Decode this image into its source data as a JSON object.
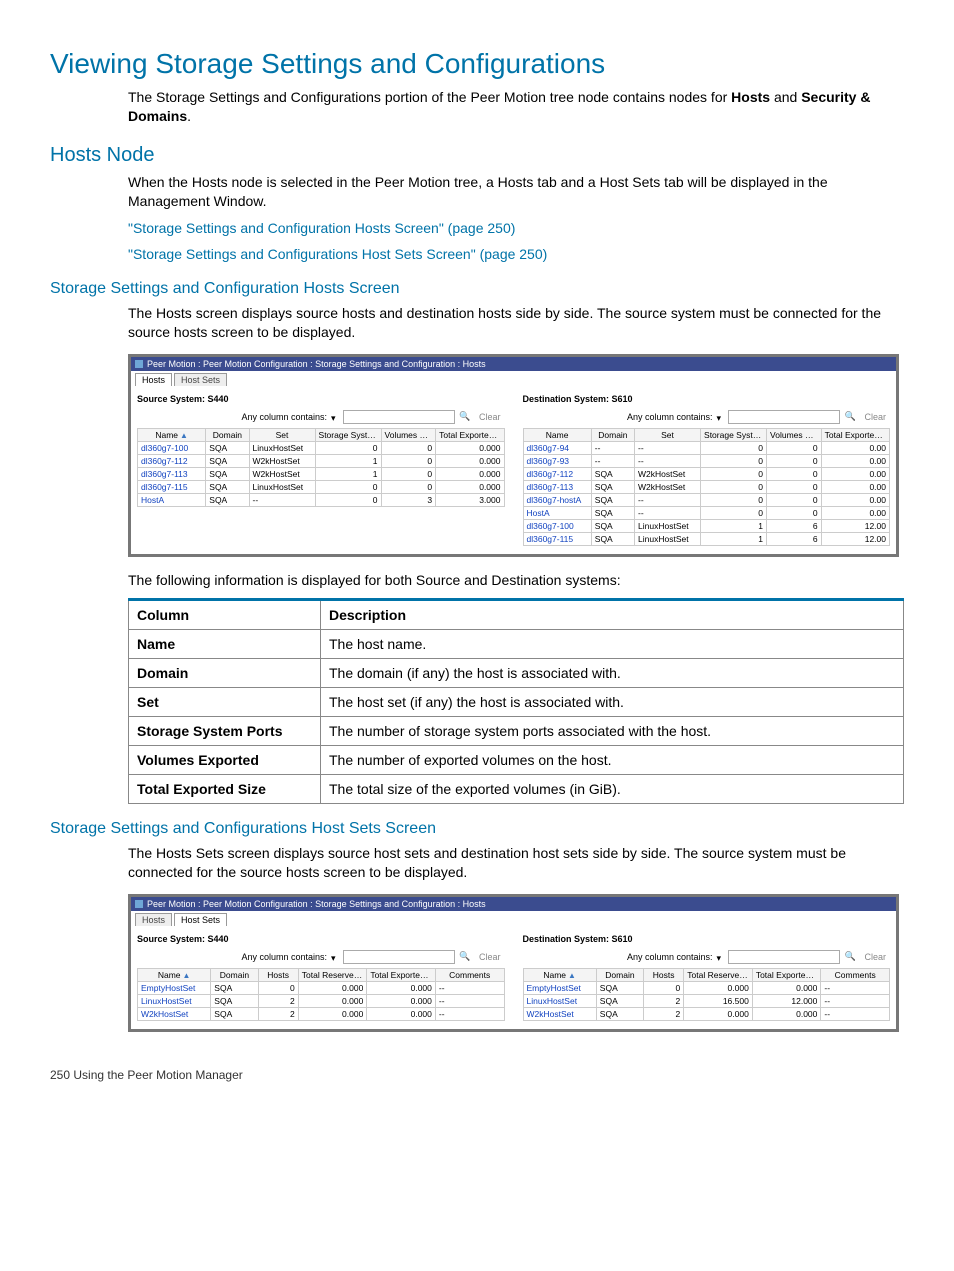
{
  "headings": {
    "h1": "Viewing Storage Settings and Configurations",
    "h2_hosts_node": "Hosts Node",
    "h3_hosts_screen": "Storage Settings and Configuration Hosts Screen",
    "h3_hostsets_screen": "Storage Settings and Configurations Host Sets Screen"
  },
  "paragraphs": {
    "intro_a": "The Storage Settings and Configurations portion of the Peer Motion tree node contains nodes for ",
    "intro_b": " and ",
    "intro_c": ".",
    "intro_bold1": "Hosts",
    "intro_bold2": "Security & Domains",
    "hosts_node": "When the Hosts node is selected in the Peer Motion tree, a Hosts tab and a Host Sets tab will be displayed in the Management Window.",
    "link_hosts": "\"Storage Settings and Configuration Hosts Screen\" (page 250)",
    "link_hostsets": "\"Storage Settings and Configurations Host Sets Screen\" (page 250)",
    "hosts_screen": "The Hosts screen displays source hosts and destination hosts side by side. The source system must be connected for the source hosts screen to be displayed.",
    "table_lead": "The following information is displayed for both Source and Destination systems:",
    "hostsets_screen": "The Hosts Sets screen displays source host sets and destination host sets side by side. The source system must be connected for the source hosts screen to be displayed."
  },
  "desc_table": {
    "head_col": "Column",
    "head_desc": "Description",
    "rows": [
      {
        "c": "Name",
        "d": "The host name."
      },
      {
        "c": "Domain",
        "d": "The domain (if any) the host is associated with."
      },
      {
        "c": "Set",
        "d": "The host set (if any) the host is associated with."
      },
      {
        "c": "Storage System Ports",
        "d": "The number of storage system ports associated with the host."
      },
      {
        "c": "Volumes Exported",
        "d": "The number of exported volumes on the host."
      },
      {
        "c": "Total Exported Size",
        "d": "The total size of the exported volumes (in GiB)."
      }
    ]
  },
  "shot_common": {
    "titlebar": "Peer Motion : Peer Motion Configuration : Storage Settings and Configuration : Hosts",
    "tab_hosts": "Hosts",
    "tab_hostsets": "Host Sets",
    "src_title": "Source System: S440",
    "dst_title": "Destination System: S610",
    "any_col": "Any column contains:",
    "clear": "Clear"
  },
  "hosts_shot": {
    "cols": [
      "Name",
      "Domain",
      "Set",
      "Storage System Ports",
      "Volumes Exported",
      "Total Exported Size (GB)"
    ],
    "src_rows": [
      {
        "name": "dl360g7-100",
        "domain": "SQA",
        "set": "LinuxHostSet",
        "ssp": "0",
        "ve": "0",
        "tes": "0.000"
      },
      {
        "name": "dl360g7-112",
        "domain": "SQA",
        "set": "W2kHostSet",
        "ssp": "1",
        "ve": "0",
        "tes": "0.000"
      },
      {
        "name": "dl360g7-113",
        "domain": "SQA",
        "set": "W2kHostSet",
        "ssp": "1",
        "ve": "0",
        "tes": "0.000"
      },
      {
        "name": "dl360g7-115",
        "domain": "SQA",
        "set": "LinuxHostSet",
        "ssp": "0",
        "ve": "0",
        "tes": "0.000"
      },
      {
        "name": "HostA",
        "domain": "SQA",
        "set": "--",
        "ssp": "0",
        "ve": "3",
        "tes": "3.000"
      }
    ],
    "dst_rows": [
      {
        "name": "dl360g7-94",
        "domain": "--",
        "set": "--",
        "ssp": "0",
        "ve": "0",
        "tes": "0.00"
      },
      {
        "name": "dl360g7-93",
        "domain": "--",
        "set": "--",
        "ssp": "0",
        "ve": "0",
        "tes": "0.00"
      },
      {
        "name": "dl360g7-112",
        "domain": "SQA",
        "set": "W2kHostSet",
        "ssp": "0",
        "ve": "0",
        "tes": "0.00"
      },
      {
        "name": "dl360g7-113",
        "domain": "SQA",
        "set": "W2kHostSet",
        "ssp": "0",
        "ve": "0",
        "tes": "0.00"
      },
      {
        "name": "dl360g7-hostA",
        "domain": "SQA",
        "set": "--",
        "ssp": "0",
        "ve": "0",
        "tes": "0.00"
      },
      {
        "name": "HostA",
        "domain": "SQA",
        "set": "--",
        "ssp": "0",
        "ve": "0",
        "tes": "0.00"
      },
      {
        "name": "dl360g7-100",
        "domain": "SQA",
        "set": "LinuxHostSet",
        "ssp": "1",
        "ve": "6",
        "tes": "12.00"
      },
      {
        "name": "dl360g7-115",
        "domain": "SQA",
        "set": "LinuxHostSet",
        "ssp": "1",
        "ve": "6",
        "tes": "12.00"
      }
    ]
  },
  "hostsets_shot": {
    "cols": [
      "Name",
      "Domain",
      "Hosts",
      "Total Reserved Size (GB)",
      "Total Exported Size (GB)",
      "Comments"
    ],
    "src_rows": [
      {
        "name": "EmptyHostSet",
        "domain": "SQA",
        "hosts": "0",
        "trs": "0.000",
        "tes": "0.000",
        "c": "--"
      },
      {
        "name": "LinuxHostSet",
        "domain": "SQA",
        "hosts": "2",
        "trs": "0.000",
        "tes": "0.000",
        "c": "--"
      },
      {
        "name": "W2kHostSet",
        "domain": "SQA",
        "hosts": "2",
        "trs": "0.000",
        "tes": "0.000",
        "c": "--"
      }
    ],
    "dst_rows": [
      {
        "name": "EmptyHostSet",
        "domain": "SQA",
        "hosts": "0",
        "trs": "0.000",
        "tes": "0.000",
        "c": "--"
      },
      {
        "name": "LinuxHostSet",
        "domain": "SQA",
        "hosts": "2",
        "trs": "16.500",
        "tes": "12.000",
        "c": "--"
      },
      {
        "name": "W2kHostSet",
        "domain": "SQA",
        "hosts": "2",
        "trs": "0.000",
        "tes": "0.000",
        "c": "--"
      }
    ]
  },
  "footer": "250   Using the Peer Motion Manager"
}
